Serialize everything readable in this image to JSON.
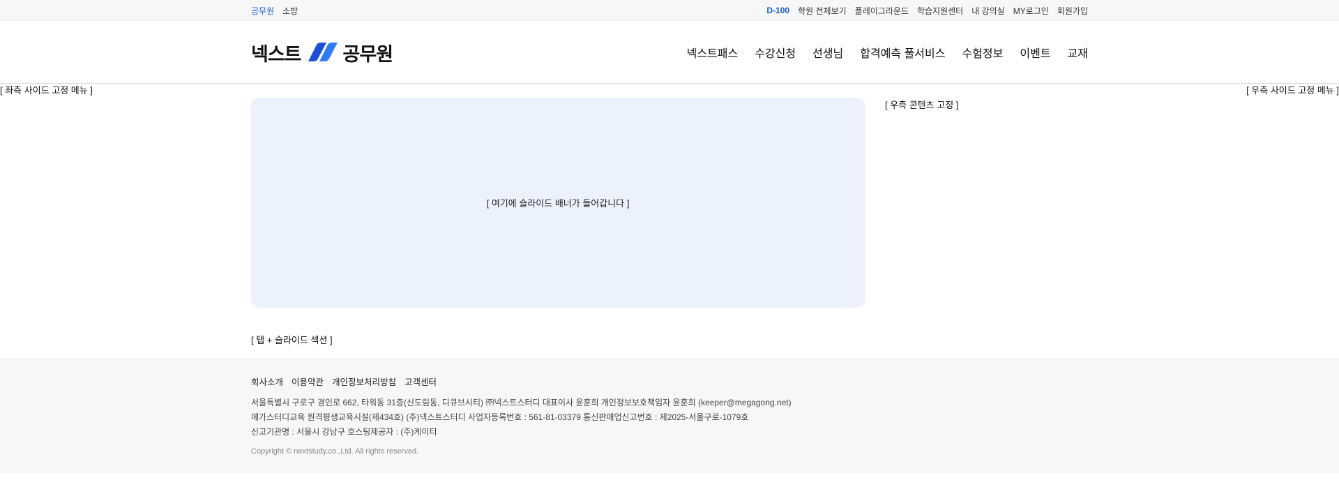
{
  "topbar": {
    "left_links": [
      "공무원",
      "소방"
    ],
    "dday": "D-100",
    "right_links": [
      "학원 전체보기",
      "플레이그라운드",
      "학습지원센터",
      "내 강의실",
      "MY로그인",
      "회원가입"
    ]
  },
  "header": {
    "logo_left": "넥스트",
    "logo_right": "공무원",
    "nav": [
      "넥스트패스",
      "수강신청",
      "선생님",
      "합격예측 풀서비스",
      "수험정보",
      "이벤트",
      "교재"
    ]
  },
  "side": {
    "left_menu": "[ 좌측 사이드 고정 메뉴 ]",
    "right_menu": "[ 우측 사이드 고정 메뉴 ]"
  },
  "main": {
    "banner_text": "[ 여기에 슬라이드 배너가 들어갑니다 ]",
    "right_content": "[ 우측 콘텐츠 고정 ]",
    "tab_section": "[ 탭 + 슬라이드 섹션 ]"
  },
  "footer": {
    "links": [
      "회사소개",
      "이용약관",
      "개인정보처리방침",
      "고객센터"
    ],
    "info_lines": [
      "서울특별시 구로구 경인로 662, 타워동 31층(신도림동, 디큐브시티) ㈜넥스트스터디 대표이사 윤훈희 개인정보보호책임자 윤훈희 (keeper@megagong.net)",
      "메가스터디교육 원격평생교육시설(제434호) (주)넥스트스터디 사업자등록번호 : 561-81-03379 통신판매업신고번호 : 제2025-서울구로-1079호",
      "신고기관명 : 서울시 강남구 호스팅제공자 : (주)케이티"
    ],
    "copyright": "Copyright © nextstudy.co.,Ltd. All rights reserved."
  },
  "colors": {
    "accent": "#1a5ad7",
    "banner_bg": "#ebf2fe",
    "footer_bg": "#f6f7f8"
  }
}
